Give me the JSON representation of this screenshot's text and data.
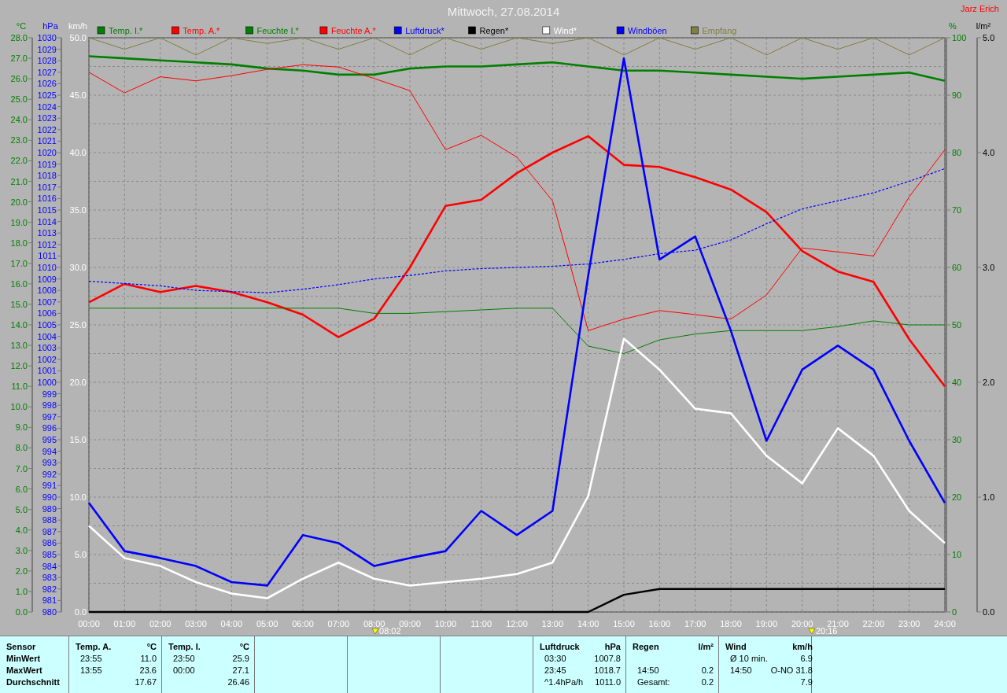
{
  "header": {
    "title": "Mittwoch, 27.08.2014",
    "author": "Jarz Erich"
  },
  "charts": [
    {
      "chart_data": {
        "type": "line",
        "x": [
          0,
          1,
          2,
          3,
          4,
          5,
          6,
          7,
          8,
          9,
          10,
          11,
          12,
          13,
          14,
          15,
          16,
          17,
          18,
          19,
          20,
          21,
          22,
          23,
          24
        ],
        "xlim": [
          0,
          24
        ],
        "xticks": [
          {
            "value": 0,
            "label": "00:00"
          },
          {
            "value": 1,
            "label": "01:00"
          },
          {
            "value": 2,
            "label": "02:00"
          },
          {
            "value": 3,
            "label": "03:00"
          },
          {
            "value": 4,
            "label": "04:00"
          },
          {
            "value": 5,
            "label": "05:00"
          },
          {
            "value": 6,
            "label": "06:00"
          },
          {
            "value": 7,
            "label": "07:00"
          },
          {
            "value": 8,
            "label": "08:00"
          },
          {
            "value": 9,
            "label": "09:00"
          },
          {
            "value": 10,
            "label": "10:00"
          },
          {
            "value": 11,
            "label": "11:00"
          },
          {
            "value": 12,
            "label": "12:00"
          },
          {
            "value": 13,
            "label": "13:00"
          },
          {
            "value": 14,
            "label": "14:00"
          },
          {
            "value": 15,
            "label": "15:00"
          },
          {
            "value": 16,
            "label": "16:00"
          },
          {
            "value": 17,
            "label": "17:00"
          },
          {
            "value": 18,
            "label": "18:00"
          },
          {
            "value": 19,
            "label": "19:00"
          },
          {
            "value": 20,
            "label": "20:00"
          },
          {
            "value": 21,
            "label": "21:00"
          },
          {
            "value": 22,
            "label": "22:00"
          },
          {
            "value": 23,
            "label": "23:00"
          },
          {
            "value": 24,
            "label": "24:00"
          }
        ],
        "ylabel": "km/h",
        "ylim": [
          0,
          50
        ],
        "yticks": [
          {
            "value": 0,
            "label": "0.0"
          },
          {
            "value": 5,
            "label": "5.0"
          },
          {
            "value": 10,
            "label": "10.0"
          },
          {
            "value": 15,
            "label": "15.0"
          },
          {
            "value": 20,
            "label": "20.0"
          },
          {
            "value": 25,
            "label": "25.0"
          },
          {
            "value": 30,
            "label": "30.0"
          },
          {
            "value": 35,
            "label": "35.0"
          },
          {
            "value": 40,
            "label": "40.0"
          },
          {
            "value": 45,
            "label": "45.0"
          },
          {
            "value": 50,
            "label": "50.0"
          }
        ],
        "y2label": "%",
        "y2lim": [
          0,
          100
        ],
        "y2ticks": [
          0,
          10,
          20,
          30,
          40,
          50,
          60,
          70,
          80,
          90,
          100
        ],
        "y3label": "°C",
        "y3lim": [
          0,
          28
        ],
        "y3ticks": [
          {
            "value": 0,
            "label": "0.0"
          },
          {
            "value": 1,
            "label": "1.0"
          },
          {
            "value": 2,
            "label": "2.0"
          },
          {
            "value": 3,
            "label": "3.0"
          },
          {
            "value": 4,
            "label": "4.0"
          },
          {
            "value": 5,
            "label": "5.0"
          },
          {
            "value": 6,
            "label": "6.0"
          },
          {
            "value": 7,
            "label": "7.0"
          },
          {
            "value": 8,
            "label": "8.0"
          },
          {
            "value": 9,
            "label": "9.0"
          },
          {
            "value": 10,
            "label": "10.0"
          },
          {
            "value": 11,
            "label": "11.0"
          },
          {
            "value": 12,
            "label": "12.0"
          },
          {
            "value": 13,
            "label": "13.0"
          },
          {
            "value": 14,
            "label": "14.0"
          },
          {
            "value": 15,
            "label": "15.0"
          },
          {
            "value": 16,
            "label": "16.0"
          },
          {
            "value": 17,
            "label": "17.0"
          },
          {
            "value": 18,
            "label": "18.0"
          },
          {
            "value": 19,
            "label": "19.0"
          },
          {
            "value": 20,
            "label": "20.0"
          },
          {
            "value": 21,
            "label": "21.0"
          },
          {
            "value": 22,
            "label": "22.0"
          },
          {
            "value": 23,
            "label": "23.0"
          },
          {
            "value": 24,
            "label": "24.0"
          },
          {
            "value": 25,
            "label": "25.0"
          },
          {
            "value": 26,
            "label": "26.0"
          },
          {
            "value": 27,
            "label": "27.0"
          },
          {
            "value": 28,
            "label": "28.0"
          }
        ],
        "series": [
          {
            "name": "Temp. I.*",
            "color": "#008000",
            "axis": "y3",
            "values": [
              27.1,
              27.0,
              26.9,
              26.8,
              26.7,
              26.5,
              26.4,
              26.2,
              26.2,
              26.5,
              26.6,
              26.6,
              26.7,
              26.8,
              26.6,
              26.4,
              26.4,
              26.3,
              26.2,
              26.1,
              26.0,
              26.1,
              26.2,
              26.3,
              25.9
            ]
          },
          {
            "name": "Temp. A.*",
            "color": "#ff0000",
            "axis": "y3",
            "values": [
              15.1,
              16.0,
              15.6,
              15.9,
              15.6,
              15.1,
              14.5,
              13.4,
              14.3,
              16.8,
              19.8,
              20.1,
              21.4,
              22.4,
              23.2,
              21.8,
              21.7,
              21.2,
              20.6,
              19.5,
              17.6,
              16.6,
              16.1,
              13.3,
              11.0
            ]
          },
          {
            "name": "Feuchte I.*",
            "color": "#008000",
            "axis": "y2",
            "values": [
              52.9,
              52.9,
              52.9,
              52.9,
              52.9,
              52.9,
              52.9,
              52.9,
              52.0,
              52.0,
              52.3,
              52.6,
              52.9,
              52.9,
              46.3,
              45.0,
              47.4,
              48.4,
              49.0,
              49.0,
              49.0,
              49.7,
              50.7,
              50.0,
              50.0
            ]
          },
          {
            "name": "Feuchte A.*",
            "color": "#ff0000",
            "axis": "y2",
            "values": [
              94.0,
              90.4,
              93.2,
              92.5,
              93.4,
              94.5,
              95.3,
              94.9,
              92.9,
              90.8,
              80.5,
              83.0,
              79.2,
              71.6,
              49.0,
              51.0,
              52.5,
              51.8,
              51.0,
              55.2,
              63.4,
              62.7,
              62.0,
              72.3,
              80.5
            ]
          },
          {
            "name": "Wind*",
            "color": "#ffffff",
            "values": [
              7.5,
              4.7,
              4.0,
              2.6,
              1.6,
              1.2,
              2.9,
              4.3,
              2.9,
              2.3,
              2.6,
              2.9,
              3.3,
              4.3,
              10.1,
              23.8,
              21.1,
              17.7,
              17.3,
              13.6,
              11.2,
              16.0,
              13.6,
              8.8,
              6.0
            ]
          },
          {
            "name": "Windböen",
            "color": "#0000ff",
            "values": [
              9.5,
              5.3,
              4.7,
              4.0,
              2.6,
              2.3,
              6.7,
              6.0,
              4.0,
              4.7,
              5.3,
              8.8,
              6.7,
              8.8,
              29.3,
              48.2,
              30.7,
              32.7,
              24.5,
              14.9,
              21.1,
              23.2,
              21.1,
              14.9,
              9.5
            ]
          },
          {
            "name": "Empfang",
            "color": "#808040",
            "axis": "y2",
            "values": [
              100,
              98,
              100,
              97,
              100,
              99,
              100,
              98,
              100,
              97,
              100,
              98,
              100,
              99,
              100,
              97,
              100,
              98,
              100,
              97,
              100,
              98,
              100,
              97,
              100
            ]
          }
        ],
        "grid": true,
        "annotations": [
          "08:02",
          "20:16"
        ]
      }
    },
    {
      "chart_data": {
        "type": "line",
        "x": [
          0,
          1,
          2,
          3,
          4,
          5,
          6,
          7,
          8,
          9,
          10,
          11,
          12,
          13,
          14,
          15,
          16,
          17,
          18,
          19,
          20,
          21,
          22,
          23,
          24
        ],
        "xlim": [
          0,
          24
        ],
        "ylabel": "hPa",
        "ylim": [
          980,
          1030
        ],
        "yticks": [
          980,
          981,
          982,
          983,
          984,
          985,
          986,
          987,
          988,
          989,
          990,
          991,
          992,
          993,
          994,
          995,
          996,
          997,
          998,
          999,
          1000,
          1001,
          1002,
          1003,
          1004,
          1005,
          1006,
          1007,
          1008,
          1009,
          1010,
          1011,
          1012,
          1013,
          1014,
          1015,
          1016,
          1017,
          1018,
          1019,
          1020,
          1021,
          1022,
          1023,
          1024,
          1025,
          1026,
          1027,
          1028,
          1029,
          1030
        ],
        "series": [
          {
            "name": "Luftdruck*",
            "color": "#0000ff",
            "line_style": "dashed",
            "values": [
              1008.8,
              1008.6,
              1008.4,
              1008.0,
              1007.9,
              1007.8,
              1008.1,
              1008.5,
              1009.0,
              1009.3,
              1009.7,
              1009.9,
              1010.0,
              1010.1,
              1010.3,
              1010.7,
              1011.2,
              1011.5,
              1012.4,
              1013.8,
              1015.1,
              1015.8,
              1016.5,
              1017.5,
              1018.6
            ]
          }
        ]
      }
    },
    {
      "chart_data": {
        "type": "line",
        "x": [
          0,
          1,
          2,
          3,
          4,
          5,
          6,
          7,
          8,
          9,
          10,
          11,
          12,
          13,
          14,
          15,
          16,
          17,
          18,
          19,
          20,
          21,
          22,
          23,
          24
        ],
        "xlim": [
          0,
          24
        ],
        "ylabel": "l/m²",
        "ylim": [
          0,
          5
        ],
        "yticks": [
          {
            "value": 0,
            "label": "0.0"
          },
          {
            "value": 1,
            "label": "1.0"
          },
          {
            "value": 2,
            "label": "2.0"
          },
          {
            "value": 3,
            "label": "3.0"
          },
          {
            "value": 4,
            "label": "4.0"
          },
          {
            "value": 5,
            "label": "5.0"
          }
        ],
        "series": [
          {
            "name": "Regen*",
            "color": "#000000",
            "values": [
              0,
              0,
              0,
              0,
              0,
              0,
              0,
              0,
              0,
              0,
              0,
              0,
              0,
              0,
              0,
              0.15,
              0.2,
              0.2,
              0.2,
              0.2,
              0.2,
              0.2,
              0.2,
              0.2,
              0.2
            ]
          }
        ]
      }
    }
  ],
  "summary_panels": [
    {
      "kind": "labels",
      "header": "Sensor",
      "rows": [
        "MinWert",
        "MaxWert",
        "Durchschnitt"
      ]
    },
    {
      "kind": "sensor",
      "name": "Temp. A.",
      "unit": "°C",
      "rows": [
        {
          "time": "23:55",
          "value": "11.0"
        },
        {
          "time": "13:55",
          "value": "23.6"
        },
        {
          "value": "17.67"
        }
      ]
    },
    {
      "kind": "sensor",
      "name": "Temp. I.",
      "unit": "°C",
      "rows": [
        {
          "time": "23:50",
          "value": "25.9"
        },
        {
          "time": "00:00",
          "value": "27.1"
        },
        {
          "value": "26.46"
        }
      ]
    },
    {
      "kind": "blank"
    },
    {
      "kind": "blank"
    },
    {
      "kind": "blank"
    },
    {
      "kind": "sensor",
      "name": "Luftdruck",
      "unit": "hPa",
      "rows": [
        {
          "time": "03:30",
          "value": "1007.8"
        },
        {
          "time": "23:45",
          "value": "1018.7"
        },
        {
          "time": "^1.4hPa/h",
          "value": "1011.0"
        }
      ]
    },
    {
      "kind": "sensor",
      "name": "Regen",
      "unit": "l/m²",
      "rows": [
        {},
        {
          "time": "14:50",
          "value": "0.2"
        },
        {
          "time": "Gesamt:",
          "value": "0.2"
        }
      ]
    },
    {
      "kind": "sensor",
      "name": "Wind",
      "unit": "km/h",
      "rows": [
        {
          "time": "Ø 10 min.",
          "value": "6.9"
        },
        {
          "time": "14:50",
          "value": "O-NO 31.8"
        },
        {
          "value": "7.9"
        }
      ]
    }
  ]
}
